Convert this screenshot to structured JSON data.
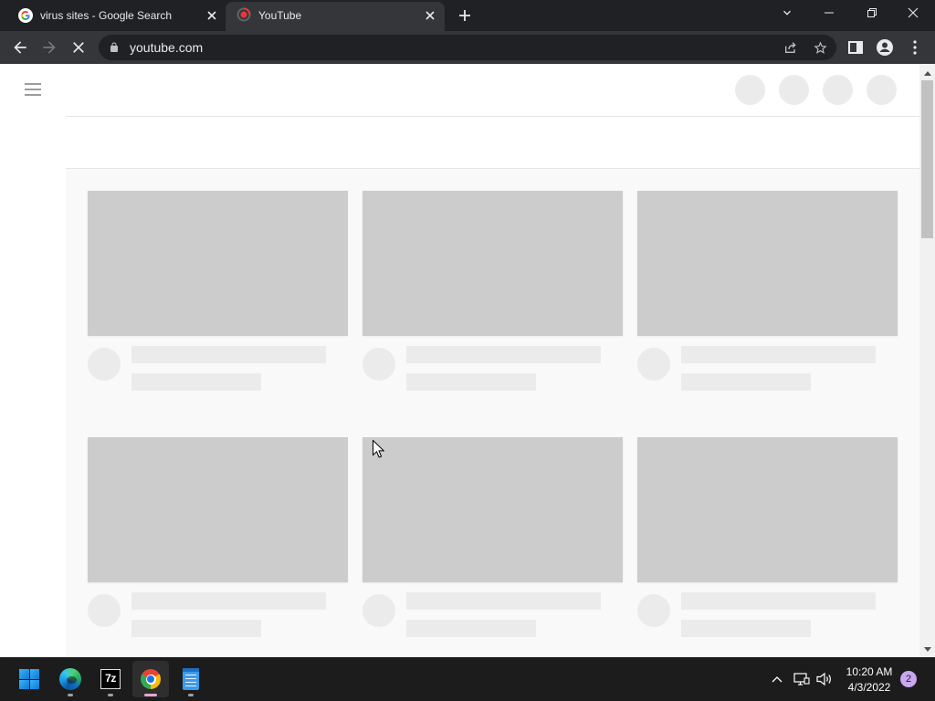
{
  "browser": {
    "tabs": [
      {
        "title": "virus sites - Google Search",
        "favicon": "google-g-icon",
        "active": false
      },
      {
        "title": "YouTube",
        "favicon": "youtube-loading-icon",
        "active": true
      }
    ],
    "new_tab_icon": "plus-icon",
    "window_controls": [
      "tab-search-chevron-icon",
      "minimize-icon",
      "restore-icon",
      "close-icon"
    ],
    "toolbar": {
      "back_icon": "arrow-left-icon",
      "forward_icon": "arrow-right-icon",
      "stop_icon": "stop-loading-icon",
      "url": "youtube.com",
      "lock_icon": "lock-icon",
      "share_icon": "share-icon",
      "bookmark_icon": "star-icon",
      "side_panel_icon": "side-panel-icon",
      "profile_icon": "profile-icon",
      "menu_icon": "kebab-menu-icon"
    }
  },
  "page": {
    "state": "loading",
    "menu_icon": "hamburger-icon"
  },
  "taskbar": {
    "apps": [
      {
        "icon": "windows-start-icon"
      },
      {
        "icon": "microsoft-edge-icon"
      },
      {
        "icon": "seven-zip-icon",
        "logo_text": "7z"
      },
      {
        "icon": "google-chrome-icon",
        "active": true
      },
      {
        "icon": "notepad-icon"
      }
    ],
    "tray_icons": [
      "chevron-up-icon",
      "network-icon",
      "volume-icon"
    ],
    "clock": {
      "time": "10:20 AM",
      "date": "4/3/2022"
    },
    "notification_count": "2"
  },
  "colors": {
    "tab_strip": "#202124",
    "toolbar": "#35363a",
    "page_background": "#f9f9f9",
    "skeleton_thumbnail": "#cccccc",
    "skeleton_text": "#ebebeb",
    "taskbar": "#1c1c1c",
    "notification_badge": "#c9a8ef"
  }
}
